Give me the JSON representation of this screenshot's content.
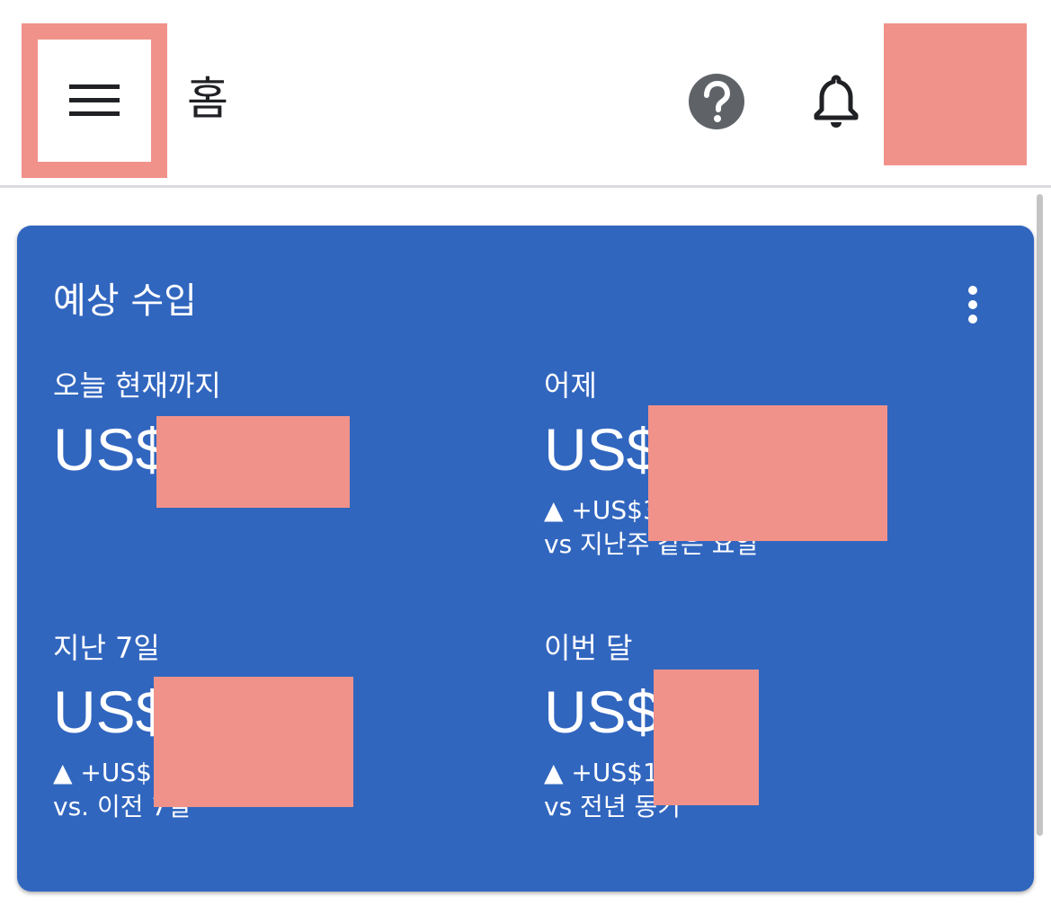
{
  "header": {
    "title": "홈",
    "menu_icon": "hamburger-menu-icon",
    "help_icon": "help-circle-icon",
    "notification_icon": "bell-icon"
  },
  "colors": {
    "card_background": "#3166bf",
    "redaction": "#f0928a",
    "icon_gray": "#5f6368"
  },
  "card": {
    "title": "예상 수입",
    "more_icon": "more-vertical-icon",
    "metrics": [
      {
        "label": "오늘 현재까지",
        "value": "US$",
        "change": "",
        "compare": ""
      },
      {
        "label": "어제",
        "value": "US$",
        "change": "▲ +US$3",
        "compare": "vs 지난주 같은 요일"
      },
      {
        "label": "지난 7일",
        "value": "US$",
        "change": "▲ +US$2",
        "compare": "vs. 이전 7일"
      },
      {
        "label": "이번 달",
        "value": "US$",
        "change": "▲ +US$1",
        "compare": "vs 전년 동기"
      }
    ]
  }
}
